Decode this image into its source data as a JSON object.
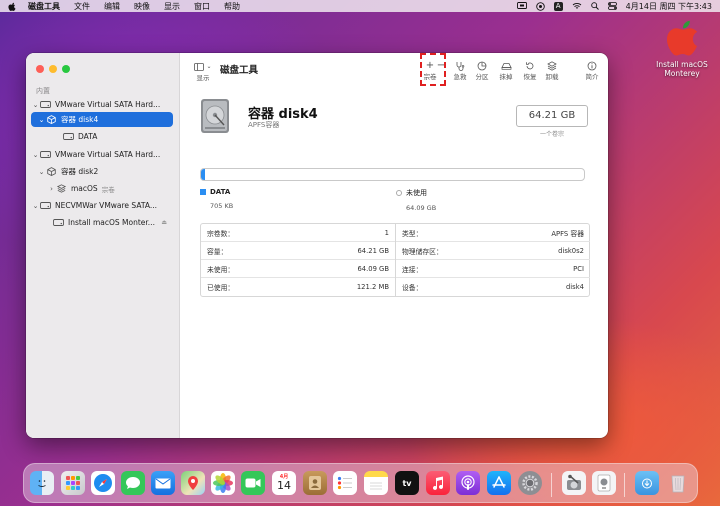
{
  "menubar": {
    "app_name": "磁盘工具",
    "menus": [
      "文件",
      "编辑",
      "映像",
      "显示",
      "窗口",
      "帮助"
    ],
    "clock": "4月14日 周四 下午3:43",
    "input_badge": "A"
  },
  "desktop": {
    "icon_label_line1": "Install macOS",
    "icon_label_line2": "Monterey"
  },
  "window": {
    "title": "磁盘工具",
    "toolbar": {
      "view_label": "显示",
      "volume_label": "宗卷",
      "rescue_label": "急救",
      "partition_label": "分区",
      "erase_label": "抹掉",
      "restore_label": "恢复",
      "unmount_label": "卸载",
      "info_label": "简介"
    },
    "sidebar": {
      "section": "内置",
      "items": [
        {
          "label": "VMware Virtual SATA Hard...",
          "sub": ""
        },
        {
          "label": "容器 disk4",
          "sub": ""
        },
        {
          "label": "DATA",
          "sub": ""
        },
        {
          "label": "VMware Virtual SATA Hard...",
          "sub": ""
        },
        {
          "label": "容器 disk2",
          "sub": ""
        },
        {
          "label": "macOS",
          "sub": "宗卷"
        },
        {
          "label": "NECVMWar VMware SATA...",
          "sub": ""
        },
        {
          "label": "Install macOS Monter...",
          "sub": ""
        }
      ]
    },
    "disk": {
      "name": "容器 disk4",
      "type": "APFS容器",
      "size": "64.21 GB",
      "size_sub": "一个卷宗",
      "used_fraction": 0.011
    },
    "legend": [
      {
        "name": "DATA",
        "value": "705 KB",
        "color": "#2a8ef2"
      },
      {
        "name": "未使用",
        "value": "64.09 GB",
        "color": "#ffffff"
      }
    ],
    "info_left": [
      {
        "key": "宗卷数：",
        "value": "1"
      },
      {
        "key": "容量：",
        "value": "64.21 GB"
      },
      {
        "key": "未使用：",
        "value": "64.09 GB"
      },
      {
        "key": "已使用：",
        "value": "121.2 MB"
      }
    ],
    "info_right": [
      {
        "key": "类型：",
        "value": "APFS 容器"
      },
      {
        "key": "物理储存区：",
        "value": "disk0s2"
      },
      {
        "key": "连接：",
        "value": "PCI"
      },
      {
        "key": "设备：",
        "value": "disk4"
      }
    ]
  },
  "dock": {
    "calendar_month": "4月",
    "calendar_day": "14",
    "tv_label": "tv"
  }
}
